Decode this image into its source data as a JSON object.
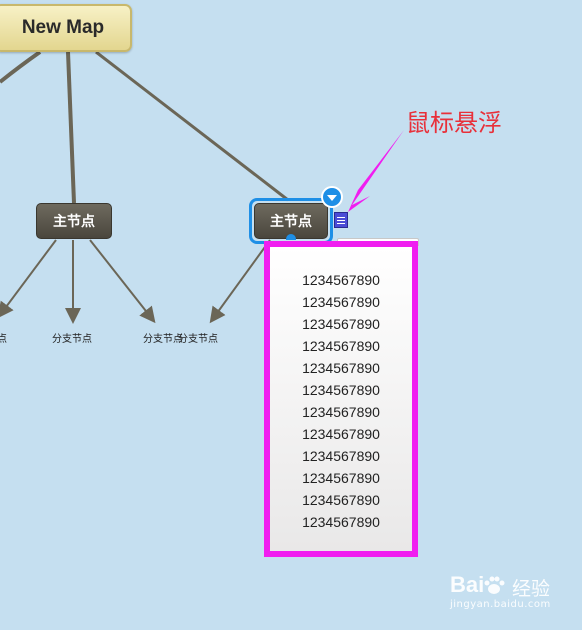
{
  "mindmap": {
    "root_title": "New Map",
    "main_nodes": [
      {
        "label": "主节点"
      },
      {
        "label": "主节点"
      }
    ],
    "branch_labels": [
      "点",
      "分支节点",
      "分支节点",
      "分支节点"
    ]
  },
  "note_popup": {
    "lines": [
      "1234567890",
      "1234567890",
      "1234567890",
      "1234567890",
      "1234567890",
      "1234567890",
      "1234567890",
      "1234567890",
      "1234567890",
      "1234567890",
      "1234567890",
      "1234567890"
    ]
  },
  "annotation": {
    "text": "鼠标悬浮"
  },
  "watermark": {
    "brand": "Bai",
    "brand_suffix": "经验",
    "url": "jingyan.baidu.com"
  },
  "colors": {
    "canvas": "#c5dff0",
    "selection": "#1e8fe6",
    "popup_border": "#f01ef0",
    "annotation": "#e8303a",
    "node_dark": "#4a463d"
  }
}
